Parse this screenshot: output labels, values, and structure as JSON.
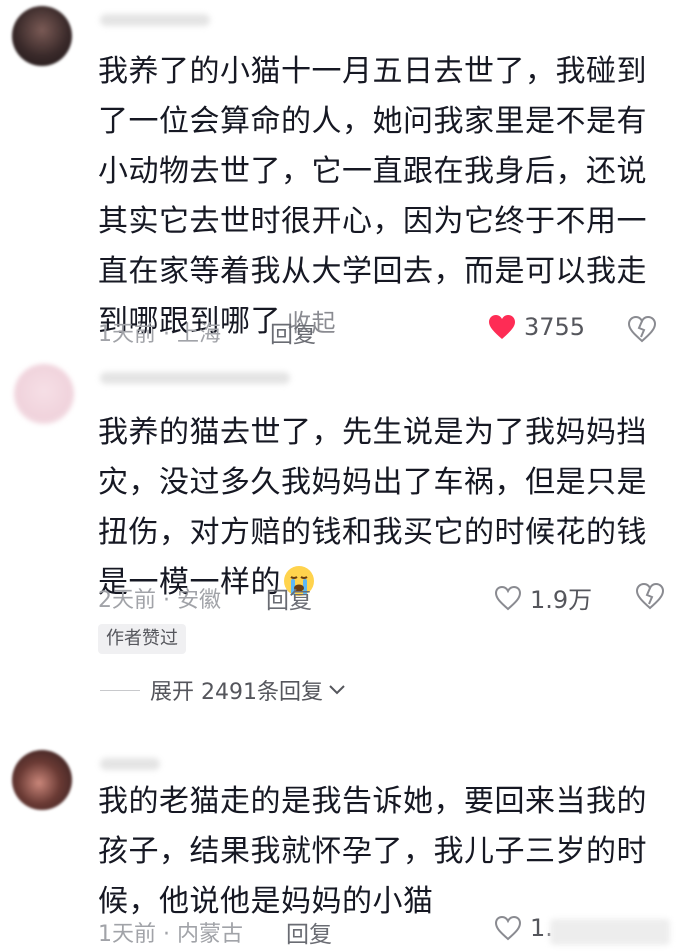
{
  "comments": [
    {
      "text": "我养了的小猫十一月五日去世了，我碰到了一位会算命的人，她问我家里是不是有小动物去世了，它一直跟在我身后，还说其实它去世时很开心，因为它终于不用一直在家等着我从大学回去，而是可以我走到哪跟到哪了",
      "collapse": "收起",
      "meta": "1天前 · 上海",
      "reply": "回复",
      "likes": "3755",
      "liked": true
    },
    {
      "text": "我养的猫去世了，先生说是为了我妈妈挡灾，没过多久我妈妈出了车祸，但是只是扭伤，对方赔的钱和我买它的时候花的钱是一模一样的",
      "emoji": "crying-face",
      "meta": "2天前 · 安徽",
      "reply": "回复",
      "likes": "1.9万",
      "liked": false,
      "author_badge": "作者赞过"
    },
    {
      "text": "我的老猫走的是我告诉她，要回来当我的孩子，结果我就怀孕了，我儿子三岁的时候，他说他是妈妈的小猫",
      "meta": "1天前 · 内蒙古",
      "reply": "回复",
      "likes": "1.",
      "liked": false
    }
  ],
  "expand_replies": "展开 2491条回复",
  "colors": {
    "like_red": "#fe2c55",
    "text": "#161823",
    "meta": "#a1a3a8"
  }
}
